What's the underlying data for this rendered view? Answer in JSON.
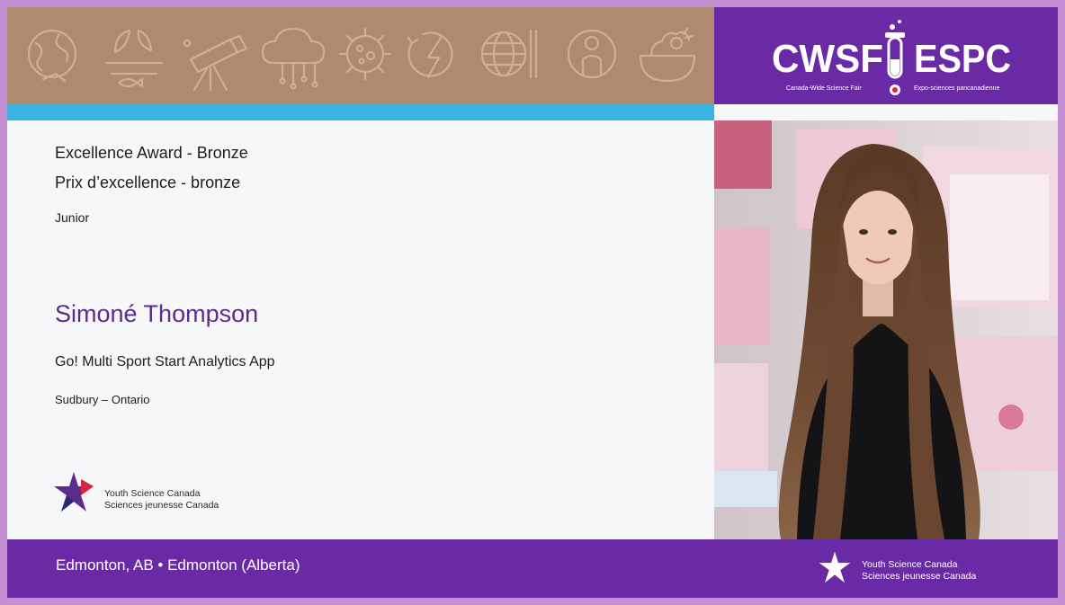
{
  "banner": {
    "icons": [
      "globe-icon",
      "plant-icon",
      "telescope-icon",
      "cloud-icon",
      "virus-icon",
      "energy-icon",
      "world-grid-icon",
      "person-icon",
      "food-bowl-icon"
    ],
    "logo_left": "CWSF",
    "logo_right": "ESPC",
    "logo_sub_left": "Canada-Wide Science Fair",
    "logo_sub_right": "Expo-sciences pancanadienne"
  },
  "award": {
    "title_en": "Excellence Award - Bronze",
    "title_fr": "Prix d’excellence - bronze",
    "category": "Junior"
  },
  "student": {
    "name": "Simoné Thompson",
    "project": "Go! Multi Sport Start Analytics App",
    "location": "Sudbury – Ontario"
  },
  "organization": {
    "name_en": "Youth Science Canada",
    "name_fr": "Sciences jeunesse Canada"
  },
  "footer": {
    "location": "Edmonton, AB • Edmonton (Alberta)"
  },
  "colors": {
    "purple": "#6a2aa6",
    "cyan": "#3bb4e2",
    "banner_brown": "#b08a6e",
    "name_purple": "#5b2b8e"
  }
}
